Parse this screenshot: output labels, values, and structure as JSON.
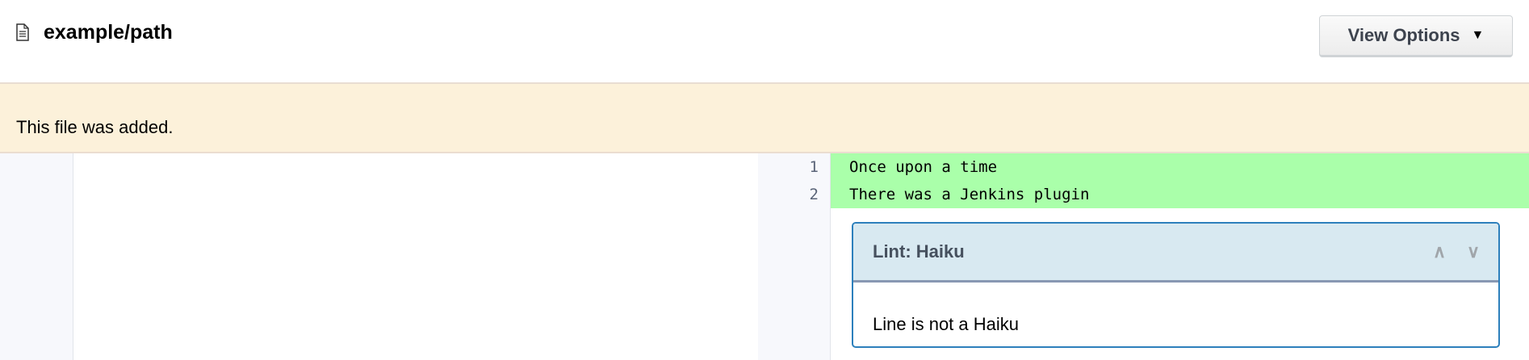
{
  "header": {
    "title": "example/path",
    "view_options_label": "View Options"
  },
  "banner": {
    "message": "This file was added."
  },
  "diff": {
    "lines": [
      {
        "number": "1",
        "text": "Once upon a time"
      },
      {
        "number": "2",
        "text": "There was a Jenkins plugin"
      }
    ],
    "added_color": "#aaffaa"
  },
  "lint": {
    "title": "Lint: Haiku",
    "message": "Line is not a Haiku"
  }
}
